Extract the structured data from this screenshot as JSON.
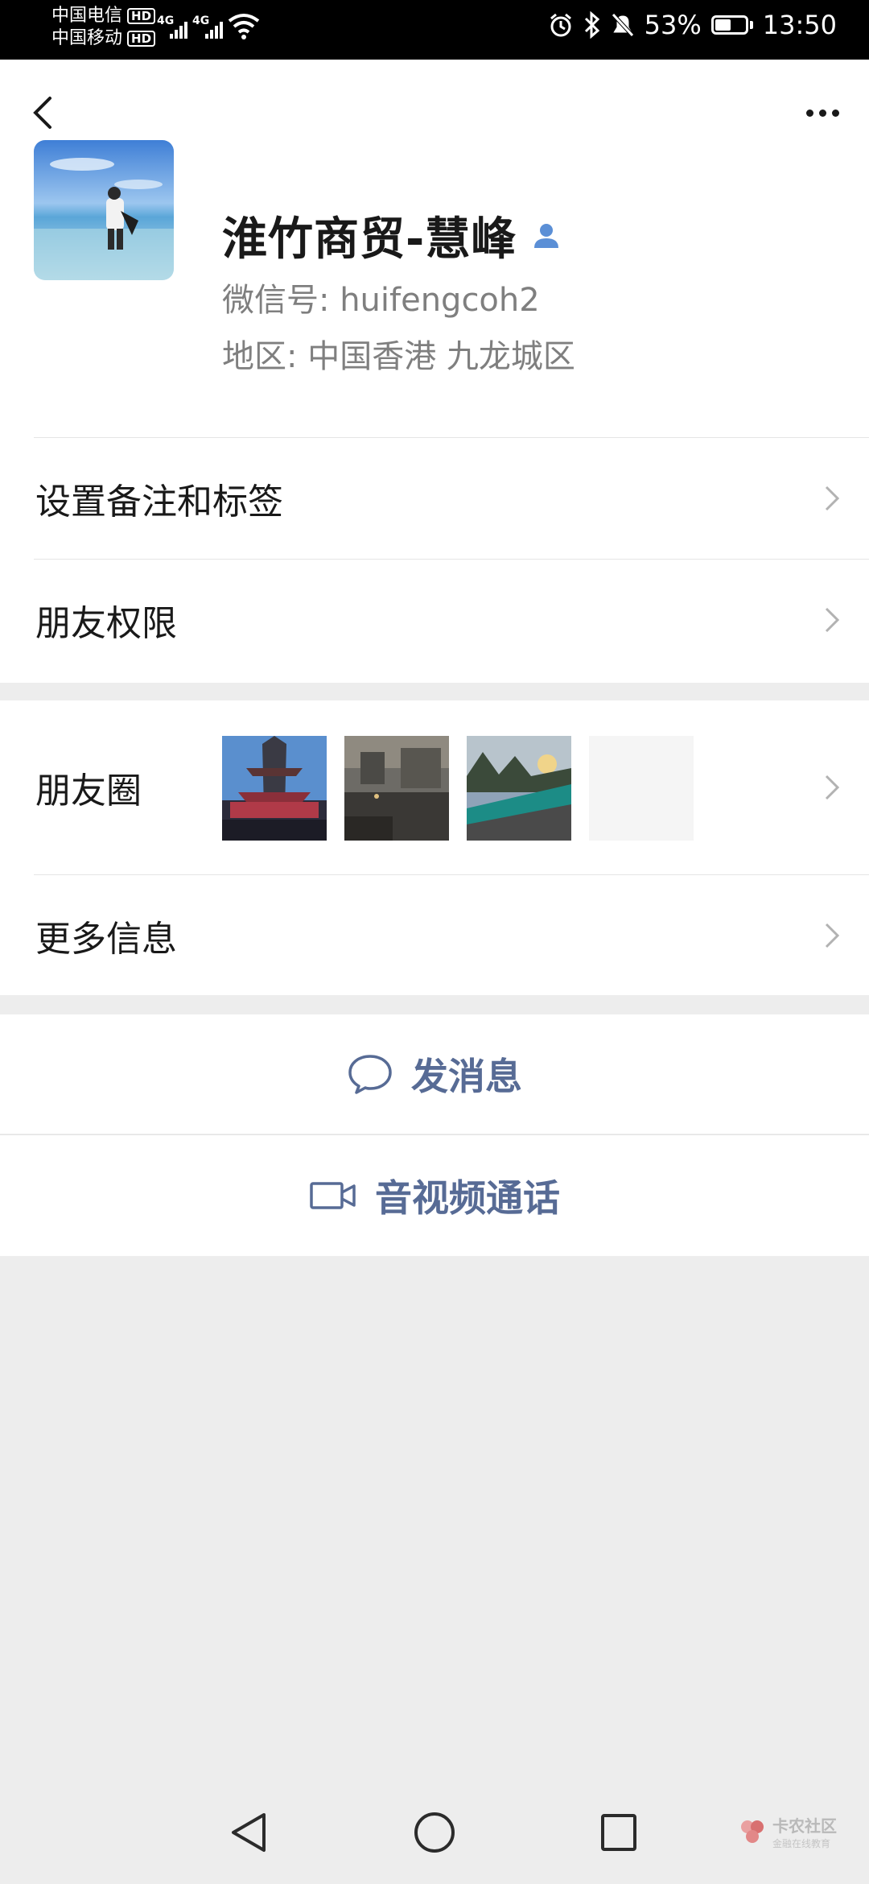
{
  "statusbar": {
    "carrier1": "中国电信",
    "carrier2": "中国移动",
    "hd": "HD",
    "net1": "4G",
    "net2": "4G",
    "battery_pct": "53%",
    "battery_level": 0.53,
    "time": "13:50"
  },
  "profile": {
    "name": "淮竹商贸-慧峰",
    "wechat_id": "微信号: huifengcoh2",
    "region": "地区: 中国香港  九龙城区"
  },
  "menu": {
    "remark": "设置备注和标签",
    "permissions": "朋友权限",
    "moments": "朋友圈",
    "more_info": "更多信息"
  },
  "actions": {
    "message": "发消息",
    "call": "音视频通话"
  },
  "watermark": {
    "title": "卡农社区",
    "subtitle": "金融在线教育"
  },
  "colors": {
    "link": "#576b95",
    "verified_icon": "#5b8fd6",
    "background": "#ededed"
  },
  "icons": {
    "back": "chevron-left-icon",
    "more": "ellipsis-icon",
    "verified": "person-icon",
    "row_arrow": "chevron-right-icon",
    "message": "chat-bubble-icon",
    "call": "video-camera-icon"
  }
}
